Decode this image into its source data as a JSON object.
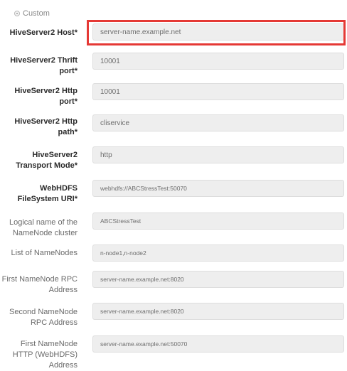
{
  "radio": {
    "label": "Custom"
  },
  "fields": {
    "host": {
      "label": "HiveServer2 Host*",
      "value": "server-name.example.net"
    },
    "thrift_port": {
      "label_line1": "HiveServer2 Thrift",
      "label_line2": "port*",
      "value": "10001"
    },
    "http_port": {
      "label_line1": "HiveServer2 Http",
      "label_line2": "port*",
      "value": "10001"
    },
    "http_path": {
      "label_line1": "HiveServer2 Http",
      "label_line2": "path*",
      "value": "cliservice"
    },
    "transport_mode": {
      "label_line1": "HiveServer2",
      "label_line2": "Transport Mode*",
      "value": "http"
    },
    "webhdfs_uri": {
      "label_line1": "WebHDFS",
      "label_line2": "FileSystem URI*",
      "value": "webhdfs://ABCStressTest:50070"
    },
    "namenode_cluster": {
      "label_line1": "Logical name of the",
      "label_line2": "NameNode cluster",
      "value": "ABCStressTest"
    },
    "namenodes": {
      "label": "List of NameNodes",
      "value": "n-node1,n-node2"
    },
    "first_rpc": {
      "label_line1": "First NameNode RPC",
      "label_line2": "Address",
      "value": "server-name.example.net:8020"
    },
    "second_rpc": {
      "label_line1": "Second NameNode",
      "label_line2": "RPC Address",
      "value": "server-name.example.net:8020"
    },
    "first_http": {
      "label_line1": "First NameNode",
      "label_line2": "HTTP (WebHDFS)",
      "label_line3": "Address",
      "value": "server-name.example.net:50070"
    }
  },
  "colors": {
    "highlight": "#e53935",
    "field_background": "#eeeeee",
    "field_border": "#dddddd"
  }
}
